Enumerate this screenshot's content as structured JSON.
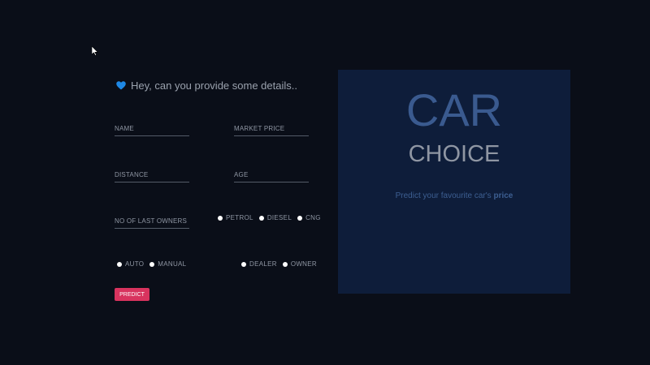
{
  "form": {
    "heading": "Hey, can you provide some details..",
    "name_placeholder": "NAME",
    "market_price_placeholder": "MARKET PRICE",
    "distance_placeholder": "DISTANCE",
    "age_placeholder": "AGE",
    "owners_placeholder": "NO OF LAST OWNERS",
    "fuel_options": [
      "PETROL",
      "DIESEL",
      "CNG"
    ],
    "transmission_options": [
      "AUTO",
      "MANUAL"
    ],
    "seller_options": [
      "DEALER",
      "OWNER"
    ],
    "predict_label": "PREDICT"
  },
  "panel": {
    "title": "CAR",
    "subtitle": "CHOICE",
    "tagline_prefix": "Predict your favourite car's ",
    "tagline_emphasis": "price"
  },
  "colors": {
    "background": "#0a0e18",
    "panel": "#0e1d3a",
    "accent": "#d8335e",
    "heart": "#1e88e5"
  },
  "icons": {
    "heading": "blue-heart-icon",
    "cursor": "mouse-pointer-icon"
  }
}
